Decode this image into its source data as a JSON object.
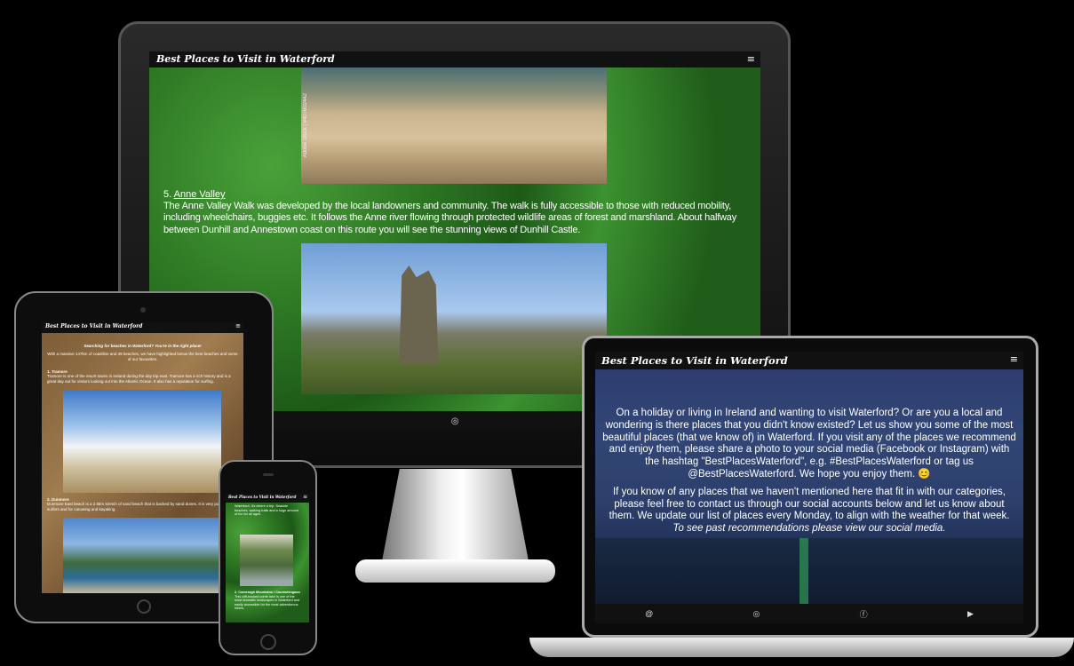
{
  "site": {
    "title": "Best Places to Visit in Waterford",
    "menu_glyph": "≡"
  },
  "monitor": {
    "image_credit": "Adobe Stock | #407602442",
    "entry_number": "5.",
    "entry_link": "Anne Valley",
    "entry_text": "The Anne Valley Walk was developed by the local landowners and community. The walk is fully accessible to those with reduced mobility, including wheelchairs, buggies etc. It follows the Anne river flowing through protected wildlife areas of forest and marshland. About halfway between Dunhill and Annestown coast on this route you will see the stunning views of Dunhill Castle.",
    "footer_icons": [
      "@",
      "◎",
      "ⓕ"
    ]
  },
  "tablet": {
    "heading": "Searching for beaches in Waterford? You're in the right place!",
    "intro": "With a massive 147km of coastline and 49 beaches, we have highlighted below the best beaches and some of our favourites.",
    "item1_title": "1. Tramore",
    "item1_text": "Tramore is one of the resort towns in Ireland during the day trip east. Tramore has a rich history and is a great day out for visitors looking out into the Atlantic Ocean. It also has a reputation for surfing.",
    "item2_title": "2. Dunmore",
    "item2_text": "Dunmore East beach is a 2.5km stretch of sand beach that is backed by sand dunes. It is very popular with surfers and for canoeing and kayaking."
  },
  "phone": {
    "top_text": "Waterford. It's where a trip. Seaside beaches, walking trails and a huge amount of fun for all ages.",
    "item_title": "2. Comeragh Mountains / Coumshingaun",
    "item_text": "This cliff-backed corrie lake is one of the most dramatic landscapes in Waterford and easily accessible for the most adventurous hikers."
  },
  "laptop": {
    "para1": "On a holiday or living in Ireland and wanting to visit Waterford? Or are you a local and wondering is there places that you didn't know existed? Let us show you some of the most beautiful places (that we know of) in Waterford. If you visit any of the places we recommend and enjoy them, please share a photo to your social media (Facebook or Instagram) with the hashtag \"BestPlacesWaterford\", e.g. #BestPlacesWaterford or tag us @BestPlacesWaterford. We hope you enjoy them. 😊",
    "para2": "If you know of any places that we haven't mentioned here that fit in with our categories, please feel free to contact us through our social accounts below and let us know about them. We update our list of places every Monday, to align with the weather for that week.",
    "para3": "To see past recommendations please view our social media.",
    "footer_icons": [
      "@",
      "◎",
      "ⓕ",
      "▶"
    ]
  }
}
